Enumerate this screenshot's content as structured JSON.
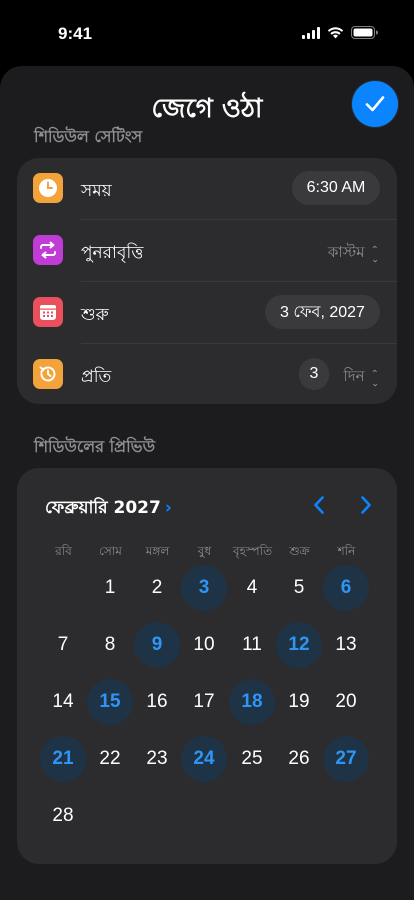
{
  "status_bar": {
    "time": "9:41"
  },
  "sheet": {
    "ghost_text": "",
    "title": "জেগে ওঠা",
    "done_icon": "checkmark-icon",
    "accent": "#0a84ff"
  },
  "settings": {
    "section_label": "শিডিউল সেটিংস",
    "time": {
      "label": "সময়",
      "value": "6:30 AM",
      "icon": "clock-icon",
      "color": "#f2a33a"
    },
    "repeat": {
      "label": "পুনরাবৃত্তি",
      "value": "কাস্টম",
      "icon": "repeat-icon",
      "color": "#c13bd6"
    },
    "start": {
      "label": "শুরু",
      "value": "3 ফেব, 2027",
      "icon": "calendar-icon",
      "color": "#e8505b"
    },
    "every": {
      "label": "প্রতি",
      "count": "3",
      "unit": "দিন",
      "icon": "history-icon",
      "color": "#f2a33a"
    }
  },
  "preview": {
    "section_label": "শিডিউলের প্রিভিউ",
    "month": "ফেব্রুয়ারি 2027",
    "weekdays": [
      "রবি",
      "সোম",
      "মঙ্গল",
      "বুধ",
      "বৃহস্পতি",
      "শুক্র",
      "শনি"
    ],
    "first_weekday_index": 1,
    "days": [
      "1",
      "2",
      "3",
      "4",
      "5",
      "6",
      "7",
      "8",
      "9",
      "10",
      "11",
      "12",
      "13",
      "14",
      "15",
      "16",
      "17",
      "18",
      "19",
      "20",
      "21",
      "22",
      "23",
      "24",
      "25",
      "26",
      "27",
      "28"
    ],
    "highlighted_days": [
      "3",
      "6",
      "9",
      "12",
      "15",
      "18",
      "21",
      "24",
      "27"
    ]
  }
}
